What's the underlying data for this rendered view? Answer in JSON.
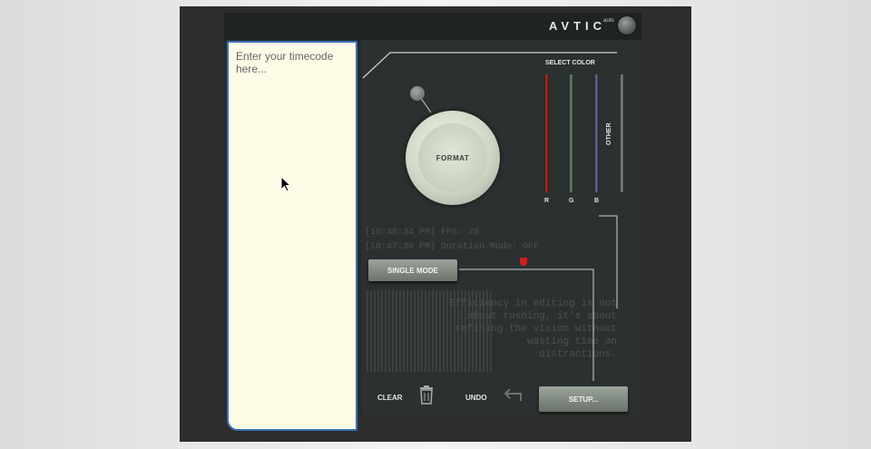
{
  "header": {
    "brand": "AVTIC",
    "brand_superscript": "auto"
  },
  "notepad": {
    "placeholder": "Enter your timecode here..."
  },
  "knob": {
    "label": "FORMAT"
  },
  "color_select": {
    "title": "SELECT COLOR",
    "sliders": [
      {
        "label": "R",
        "color": "#c3241e"
      },
      {
        "label": "G",
        "color": "#6e8f72"
      },
      {
        "label": "B",
        "color": "#6b6fa0"
      },
      {
        "label": "OTHER",
        "color": "#8a8f8b"
      }
    ]
  },
  "log": {
    "line1": "[10:46:34 PM] FPS: 25",
    "line2": "[10:47:30 PM] Duration Mode: OFF"
  },
  "mode": {
    "single_mode_label": "SINGLE MODE"
  },
  "quote": {
    "lines": [
      "Efficiency in editing is not",
      "about rushing, it's about",
      "refining the vision without",
      "wasting time on",
      "distractions."
    ]
  },
  "actions": {
    "clear_label": "CLEAR",
    "undo_label": "UNDO",
    "setup_label": "SETUP..."
  },
  "colors": {
    "accent_red": "#d11c1c",
    "focus_border": "#3a6fb5",
    "notepad_bg": "#fbfbe6"
  }
}
